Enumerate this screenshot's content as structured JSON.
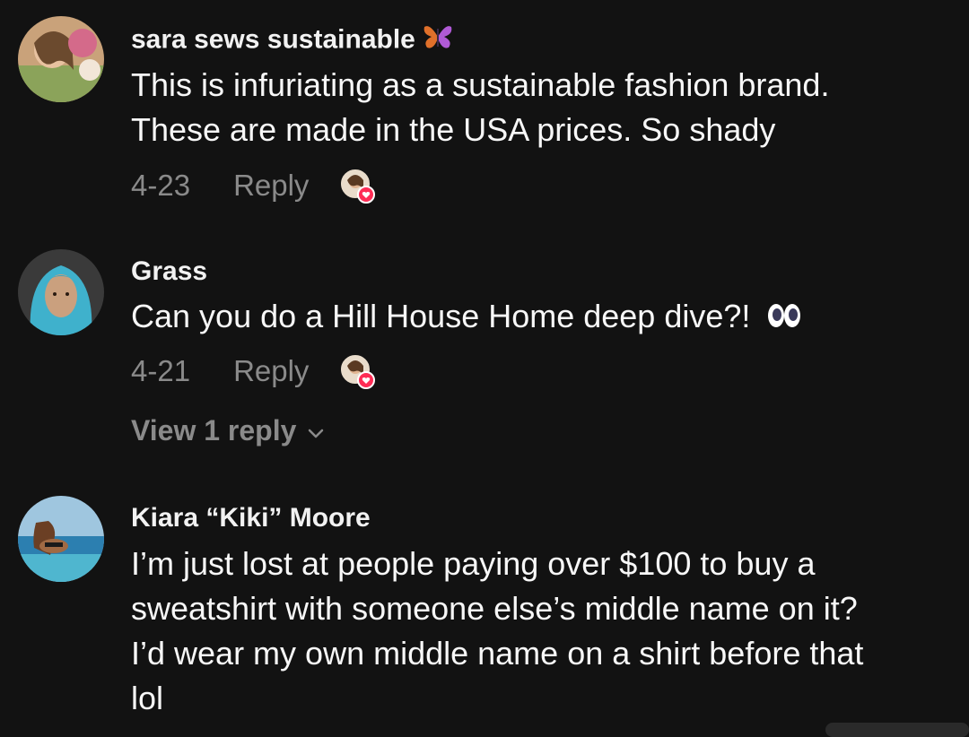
{
  "comments": [
    {
      "username": "sara sews sustainable",
      "username_emoji": "butterfly-icon",
      "text_lines": [
        "This is infuriating as a sustainable fashion brand.",
        "These are made in the USA prices. So shady"
      ],
      "date": "4-23",
      "reply_label": "Reply"
    },
    {
      "username": "Grass",
      "text": "Can you do a Hill House Home deep dive?!",
      "text_emoji": "eyes-icon",
      "date": "4-21",
      "reply_label": "Reply",
      "view_replies_label": "View 1 reply"
    },
    {
      "username": "Kiara “Kiki” Moore",
      "text_lines": [
        "I’m just lost at people paying over $100 to buy a",
        "sweatshirt with someone else’s middle name on it?",
        "I’d wear my own middle name on a shirt before that",
        "lol"
      ]
    }
  ],
  "colors": {
    "background": "#121212",
    "meta_text": "#8a8a8a",
    "heart_badge": "#fe2c55"
  }
}
